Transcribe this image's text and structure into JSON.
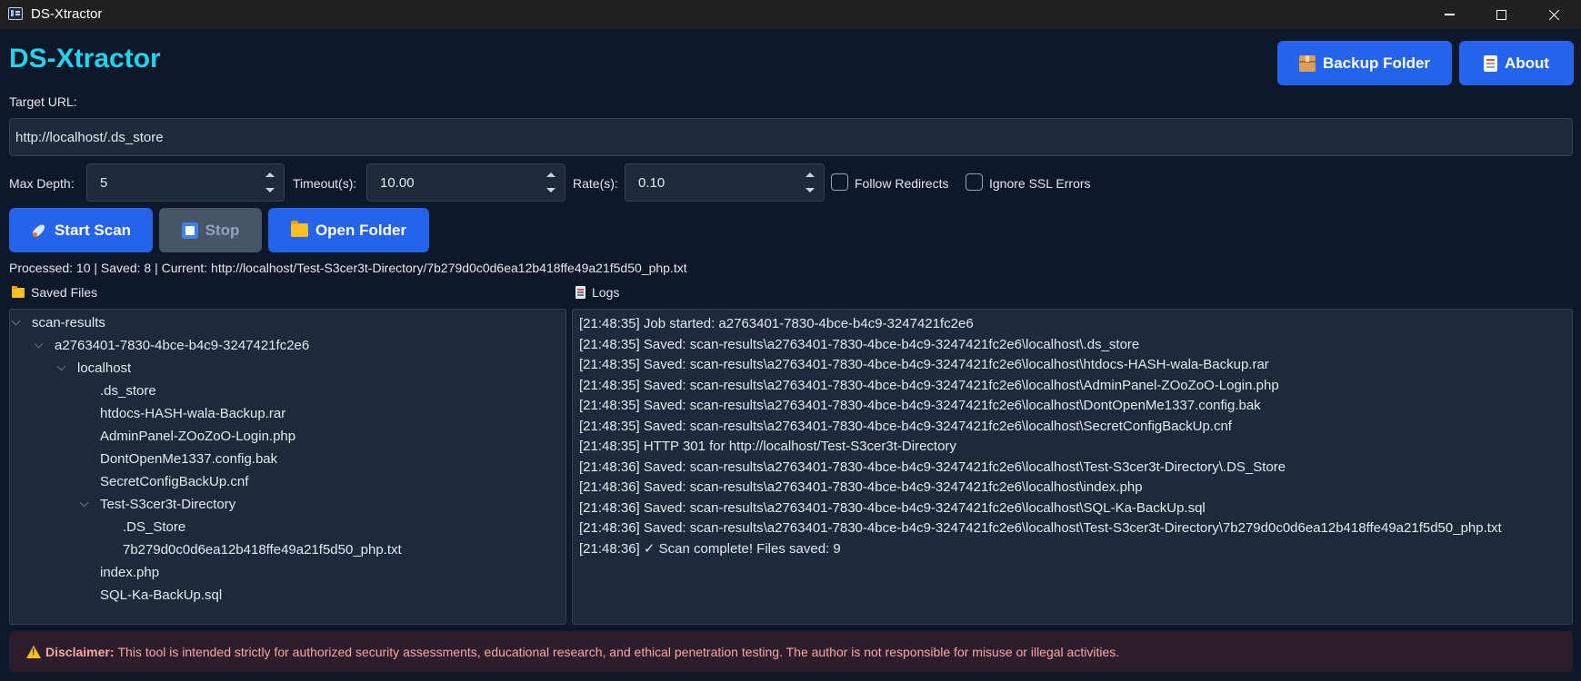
{
  "window": {
    "title": "DS-Xtractor"
  },
  "header": {
    "title": "DS-Xtractor",
    "backup_button": {
      "label": "Backup Folder",
      "icon": "package-icon"
    },
    "about_button": {
      "label": "About",
      "icon": "document-icon"
    }
  },
  "form": {
    "target_url_label": "Target URL:",
    "target_url_value": "http://localhost/.ds_store",
    "max_depth_label": "Max Depth:",
    "max_depth_value": "5",
    "timeout_label": "Timeout(s):",
    "timeout_value": "10.00",
    "rate_label": "Rate(s):",
    "rate_value": "0.10",
    "follow_redirects_label": "Follow Redirects",
    "follow_redirects_checked": false,
    "ignore_ssl_label": "Ignore SSL Errors",
    "ignore_ssl_checked": false
  },
  "actions": {
    "start_label": "Start Scan",
    "stop_label": "Stop",
    "open_folder_label": "Open Folder"
  },
  "status_text": "Processed: 10 | Saved: 8 | Current: http://localhost/Test-S3cer3t-Directory/7b279d0c0d6ea12b418ffe49a21f5d50_php.txt",
  "saved_files": {
    "title": "Saved Files",
    "tree": [
      {
        "label": "scan-results",
        "level": 0,
        "expanded": true
      },
      {
        "label": "a2763401-7830-4bce-b4c9-3247421fc2e6",
        "level": 1,
        "expanded": true
      },
      {
        "label": "localhost",
        "level": 2,
        "expanded": true
      },
      {
        "label": ".ds_store",
        "level": 3
      },
      {
        "label": "htdocs-HASH-wala-Backup.rar",
        "level": 3
      },
      {
        "label": "AdminPanel-ZOoZoO-Login.php",
        "level": 3
      },
      {
        "label": "DontOpenMe1337.config.bak",
        "level": 3
      },
      {
        "label": "SecretConfigBackUp.cnf",
        "level": 3
      },
      {
        "label": "Test-S3cer3t-Directory",
        "level": 3,
        "expanded": true
      },
      {
        "label": ".DS_Store",
        "level": 4
      },
      {
        "label": "7b279d0c0d6ea12b418ffe49a21f5d50_php.txt",
        "level": 4
      },
      {
        "label": "index.php",
        "level": 3
      },
      {
        "label": "SQL-Ka-BackUp.sql",
        "level": 3
      }
    ]
  },
  "logs": {
    "title": "Logs",
    "lines": [
      "[21:48:35] Job started: a2763401-7830-4bce-b4c9-3247421fc2e6",
      "[21:48:35] Saved: scan-results\\a2763401-7830-4bce-b4c9-3247421fc2e6\\localhost\\.ds_store",
      "[21:48:35] Saved: scan-results\\a2763401-7830-4bce-b4c9-3247421fc2e6\\localhost\\htdocs-HASH-wala-Backup.rar",
      "[21:48:35] Saved: scan-results\\a2763401-7830-4bce-b4c9-3247421fc2e6\\localhost\\AdminPanel-ZOoZoO-Login.php",
      "[21:48:35] Saved: scan-results\\a2763401-7830-4bce-b4c9-3247421fc2e6\\localhost\\DontOpenMe1337.config.bak",
      "[21:48:35] Saved: scan-results\\a2763401-7830-4bce-b4c9-3247421fc2e6\\localhost\\SecretConfigBackUp.cnf",
      "[21:48:35] HTTP 301 for http://localhost/Test-S3cer3t-Directory",
      "[21:48:36] Saved: scan-results\\a2763401-7830-4bce-b4c9-3247421fc2e6\\localhost\\Test-S3cer3t-Directory\\.DS_Store",
      "[21:48:36] Saved: scan-results\\a2763401-7830-4bce-b4c9-3247421fc2e6\\localhost\\index.php",
      "[21:48:36] Saved: scan-results\\a2763401-7830-4bce-b4c9-3247421fc2e6\\localhost\\SQL-Ka-BackUp.sql",
      "[21:48:36] Saved: scan-results\\a2763401-7830-4bce-b4c9-3247421fc2e6\\localhost\\Test-S3cer3t-Directory\\7b279d0c0d6ea12b418ffe49a21f5d50_php.txt",
      "[21:48:36] ✓ Scan complete! Files saved: 9"
    ]
  },
  "disclaimer": {
    "heading": "Disclaimer:",
    "text": "This tool is intended strictly for authorized security assessments, educational research, and ethical penetration testing. The author is not responsible for misuse or illegal activities."
  },
  "colors": {
    "background": "#0f172a",
    "panel": "#1e293b",
    "accent_title": "#22d3ee",
    "primary_button": "#2563eb",
    "disabled_button": "#475569",
    "disclaimer_bg": "#2b1d2a",
    "disclaimer_text": "#fca5a5"
  }
}
